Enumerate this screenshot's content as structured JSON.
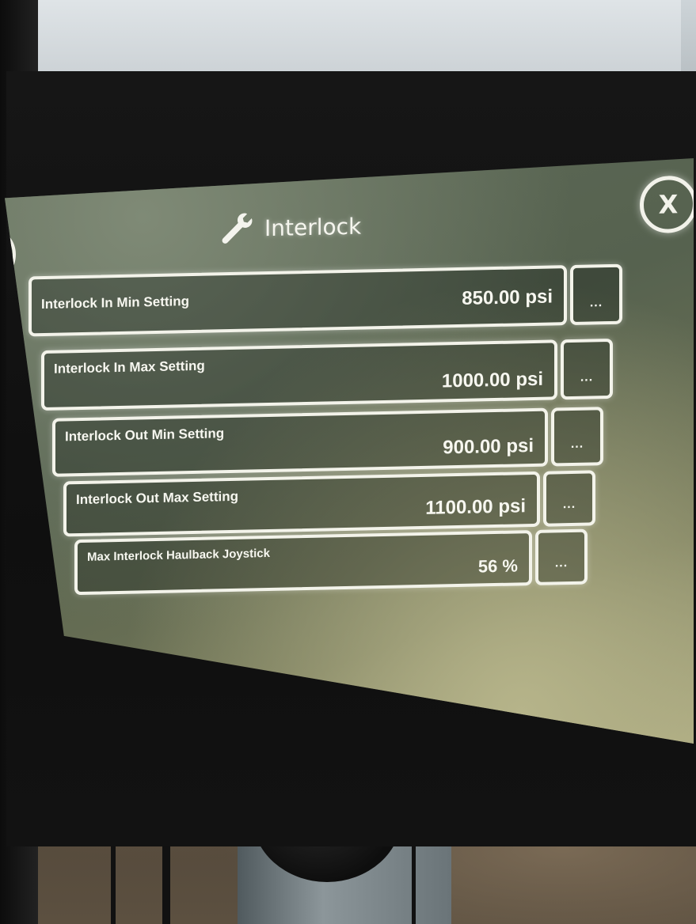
{
  "screen": {
    "title": "Interlock",
    "title_icon": "wrench-icon",
    "close_label": "X"
  },
  "settings": [
    {
      "label": "Interlock In Min Setting",
      "value": "850.00 psi",
      "more_label": "..."
    },
    {
      "label": "Interlock In Max Setting",
      "value": "1000.00 psi",
      "more_label": "..."
    },
    {
      "label": "Interlock Out Min Setting",
      "value": "900.00 psi",
      "more_label": "..."
    },
    {
      "label": "Interlock Out Max Setting",
      "value": "1100.00 psi",
      "more_label": "..."
    },
    {
      "label": "Max Interlock Haulback Joystick",
      "value": "56 %",
      "more_label": "..."
    }
  ],
  "colors": {
    "screen_bg": "#5e6a58",
    "outline": "#f3f3ea",
    "text": "#f7f7f0"
  }
}
